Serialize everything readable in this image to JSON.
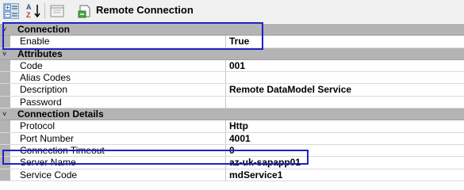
{
  "toolbar": {
    "title": "Remote Connection",
    "buttons": [
      {
        "icon": "categorized-icon",
        "pressed": true
      },
      {
        "icon": "sort-alphabetical-icon",
        "pressed": false
      },
      {
        "icon": "property-pages-icon",
        "pressed": false
      }
    ]
  },
  "grid": {
    "rows": [
      {
        "type": "category",
        "label": "Connection",
        "toggle": "˅"
      },
      {
        "type": "property",
        "name": "Enable",
        "value": "True"
      },
      {
        "type": "category",
        "label": "Attributes",
        "toggle": "˅"
      },
      {
        "type": "property",
        "name": "Code",
        "value": "001"
      },
      {
        "type": "property",
        "name": "Alias Codes",
        "value": ""
      },
      {
        "type": "property",
        "name": "Description",
        "value": "Remote DataModel Service"
      },
      {
        "type": "property",
        "name": "Password",
        "value": ""
      },
      {
        "type": "category",
        "label": "Connection Details",
        "toggle": "˅"
      },
      {
        "type": "property",
        "name": "Protocol",
        "value": "Http"
      },
      {
        "type": "property",
        "name": "Port Number",
        "value": "4001"
      },
      {
        "type": "property",
        "name": "Connection Timeout",
        "value": "0"
      },
      {
        "type": "property",
        "name": "Server Name",
        "value": "az-uk-sapapp01"
      },
      {
        "type": "property",
        "name": "Service Code",
        "value": "mdService1"
      }
    ]
  },
  "colors": {
    "highlight": "#1e22c9",
    "category_bg": "#b4b4b4",
    "toolbar_bg": "#f0f0f0"
  }
}
